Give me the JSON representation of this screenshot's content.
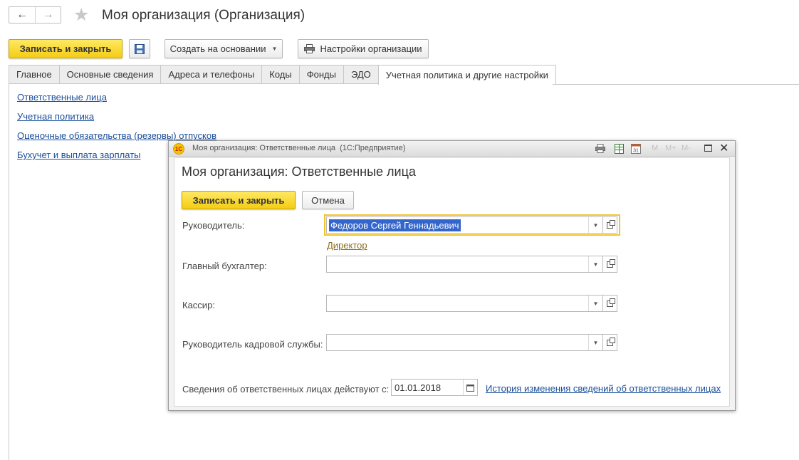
{
  "window": {
    "title": "Моя организация (Организация)"
  },
  "toolbar": {
    "save_close": "Записать и закрыть",
    "create_based": "Создать на основании",
    "org_settings": "Настройки организации"
  },
  "tabs": [
    {
      "label": "Главное"
    },
    {
      "label": "Основные сведения"
    },
    {
      "label": "Адреса и телефоны"
    },
    {
      "label": "Коды"
    },
    {
      "label": "Фонды"
    },
    {
      "label": "ЭДО"
    },
    {
      "label": "Учетная политика и другие настройки",
      "active": true
    }
  ],
  "links": [
    {
      "label": "Ответственные лица"
    },
    {
      "label": "Учетная политика"
    },
    {
      "label": "Оценочные обязательства (резервы) отпусков"
    },
    {
      "label": "Бухучет и выплата зарплаты"
    }
  ],
  "dialog": {
    "window_title": "Моя организация: Ответственные лица  (1С:Предприятие)",
    "titlebar_tools": [
      "M",
      "M+",
      "M-"
    ],
    "heading": "Моя организация: Ответственные лица",
    "save_close": "Записать и закрыть",
    "cancel": "Отмена",
    "fields": {
      "head_label": "Руководитель:",
      "head_value": "Федоров Сергей Геннадьевич",
      "head_position": "Директор",
      "chief_accountant_label": "Главный бухгалтер:",
      "chief_accountant_value": "",
      "cashier_label": "Кассир:",
      "cashier_value": "",
      "hr_head_label": "Руководитель кадровой службы:",
      "hr_head_value": ""
    },
    "effective_label": "Сведения об ответственных лицах действуют с:",
    "effective_date": "01.01.2018",
    "history_link": "История изменения сведений об ответственных лицах"
  },
  "colors": {
    "accent_yellow": "#f4cc13",
    "link_blue": "#1a4e9a",
    "selection_blue": "#3366cc",
    "focus_border": "#f2c42b"
  }
}
